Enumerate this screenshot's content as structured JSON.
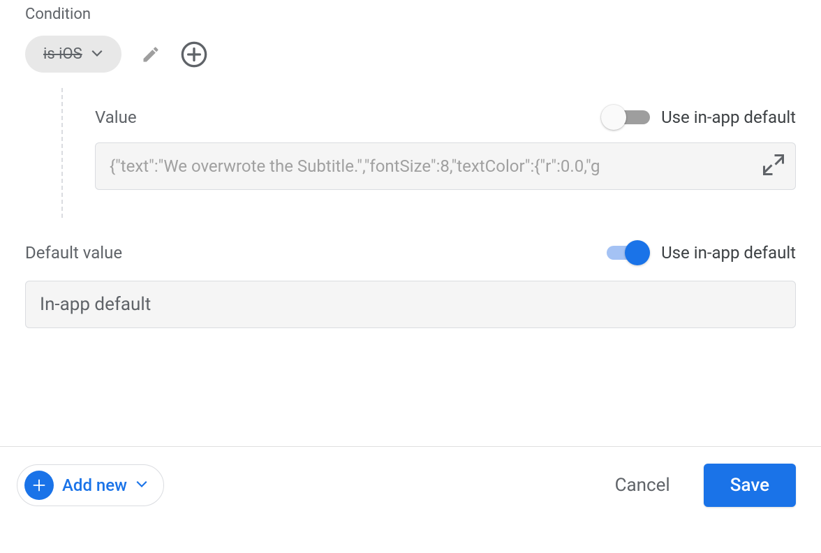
{
  "condition": {
    "label": "Condition",
    "chip_text": "is iOS"
  },
  "value": {
    "label": "Value",
    "toggle_label": "Use in-app default",
    "input_value": "{\"text\":\"We overwrote the Subtitle.\",\"fontSize\":8,\"textColor\":{\"r\":0.0,\"g"
  },
  "default_value": {
    "label": "Default value",
    "toggle_label": "Use in-app default",
    "input_value": "In-app default"
  },
  "footer": {
    "add_new_label": "Add new",
    "cancel_label": "Cancel",
    "save_label": "Save"
  }
}
